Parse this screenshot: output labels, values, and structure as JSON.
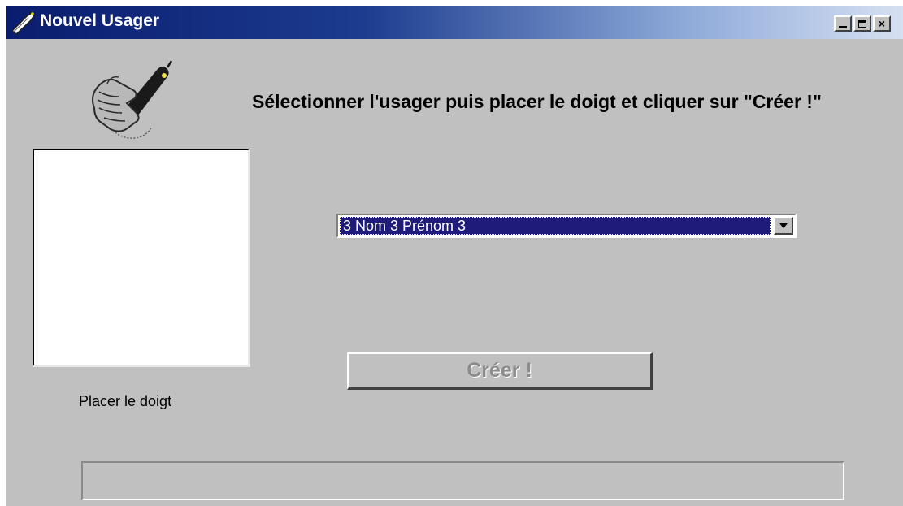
{
  "window": {
    "title": "Nouvel Usager",
    "controls": {
      "minimize": "_",
      "maximize": "□",
      "close": "×"
    }
  },
  "icons": {
    "app": "fingerprint-mouse-icon",
    "finger": "finger-on-sensor-icon"
  },
  "instruction": "Sélectionner l'usager puis placer le doigt et cliquer sur \"Créer !\"",
  "preview": {
    "label": "Placer le doigt"
  },
  "user_select": {
    "selected": "3 Nom 3 Prénom 3"
  },
  "create_button": {
    "label": "Créer !",
    "enabled": false
  },
  "status_bar": {
    "text": ""
  },
  "colors": {
    "window_bg": "#c0c0c0",
    "titlebar_start": "#0a1c6e",
    "titlebar_end": "#d6e0f2",
    "selection_bg": "#1e1b7a"
  }
}
